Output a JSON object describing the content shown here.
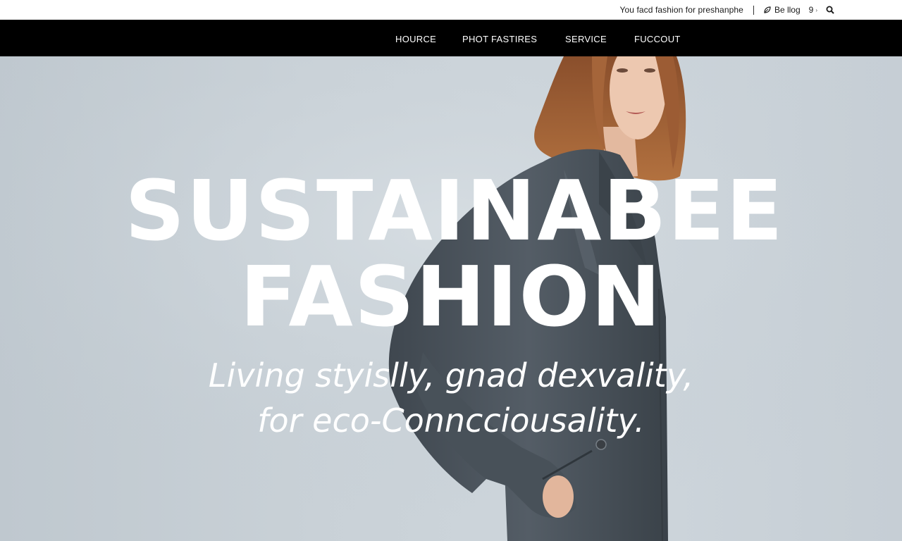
{
  "utility_bar": {
    "tagline": "You facd fashion for preshanphe",
    "blog_label": "Be llog",
    "location_label": "9",
    "location_chevron": "›",
    "icons": {
      "blog": "leaf-icon",
      "location": "location-pin-icon",
      "search": "search-icon"
    }
  },
  "nav": {
    "items": [
      {
        "label": "HOURCE"
      },
      {
        "label": "PHOT FASTIRES"
      },
      {
        "label": "SERVICE"
      },
      {
        "label": "FUCCOUT"
      }
    ]
  },
  "hero": {
    "headline_line1": "SUSTAINABEE",
    "headline_line2": "FASHION",
    "subtitle_line1": "Living styislly, gnad dexvality,",
    "subtitle_line2": "for eco-Conncciousality."
  },
  "colors": {
    "nav_bg": "#000000",
    "nav_text": "#ffffff",
    "hero_bg": "#c9d1d7",
    "coat": "#4b545c",
    "hair": "#9a5a33",
    "hero_text": "#ffffff"
  }
}
